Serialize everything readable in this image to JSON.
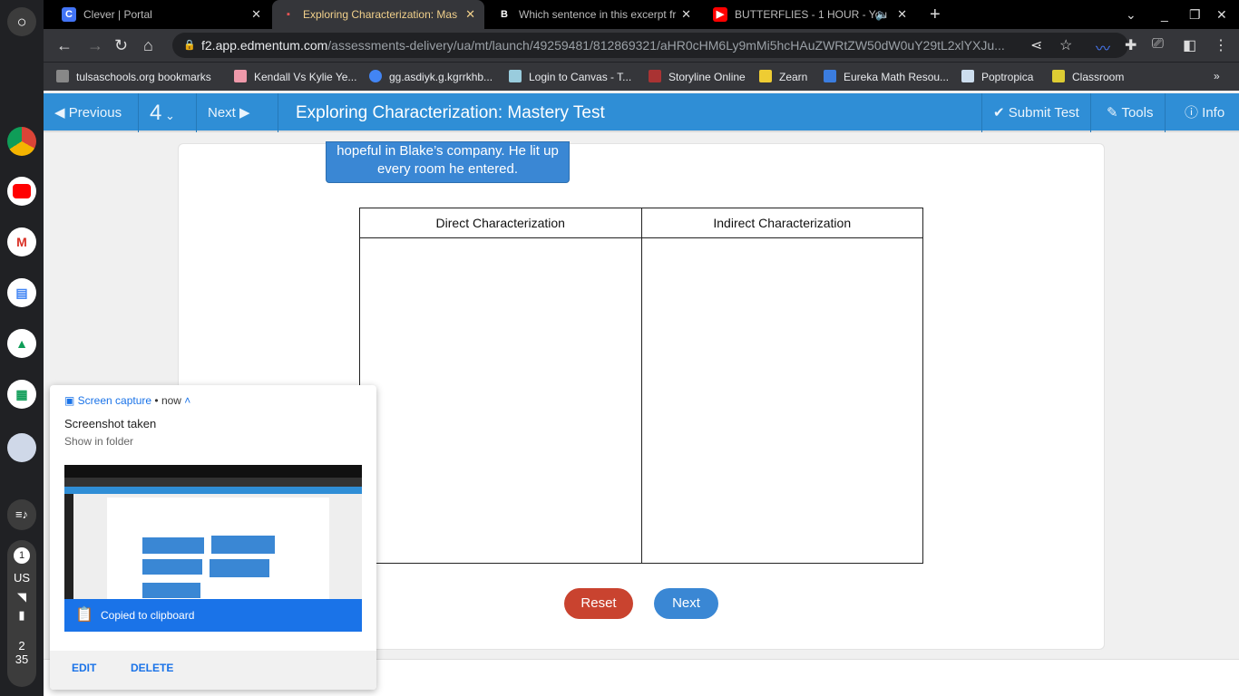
{
  "shelf": {
    "notification_count": "1",
    "ime": "US",
    "time_hour": "2",
    "time_min": "35"
  },
  "tabs": [
    {
      "title": "Clever | Portal"
    },
    {
      "title": "Exploring Characterization: Mas"
    },
    {
      "title": "Which sentence in this excerpt fr"
    },
    {
      "title": "BUTTERFLIES - 1 HOUR - You"
    }
  ],
  "address": {
    "host": "f2.app.edmentum.com",
    "path": "/assessments-delivery/ua/mt/launch/49259481/812869321/aHR0cHM6Ly9mMi5hcHAuZWRtZW50dW0uY29tL2xlYXJu..."
  },
  "bookmarks": [
    "tulsaschools.org bookmarks",
    "Kendall Vs Kylie Ye...",
    "gg.asdiyk.g.kgrrkhb...",
    "Login to Canvas - T...",
    "Storyline Online",
    "Zearn",
    "Eureka Math Resou...",
    "Poptropica",
    "Classroom"
  ],
  "header": {
    "previous": "Previous",
    "question_number": "4",
    "next": "Next",
    "title": "Exploring Characterization: Mastery Test",
    "submit": "Submit Test",
    "tools": "Tools",
    "info": "Info"
  },
  "tile": {
    "text": "hopeful in Blake’s company. He lit up every room he entered."
  },
  "table": {
    "col1": "Direct Characterization",
    "col2": "Indirect Characterization"
  },
  "buttons": {
    "reset": "Reset",
    "next": "Next"
  },
  "notification": {
    "source": "Screen capture",
    "time": "now",
    "title": "Screenshot taken",
    "subtitle": "Show in folder",
    "banner": "Copied to clipboard",
    "edit": "EDIT",
    "delete": "DELETE"
  },
  "colors": {
    "header_blue": "#2f8ed6",
    "reset_red": "#c9432f",
    "next_blue": "#3a87d4"
  }
}
